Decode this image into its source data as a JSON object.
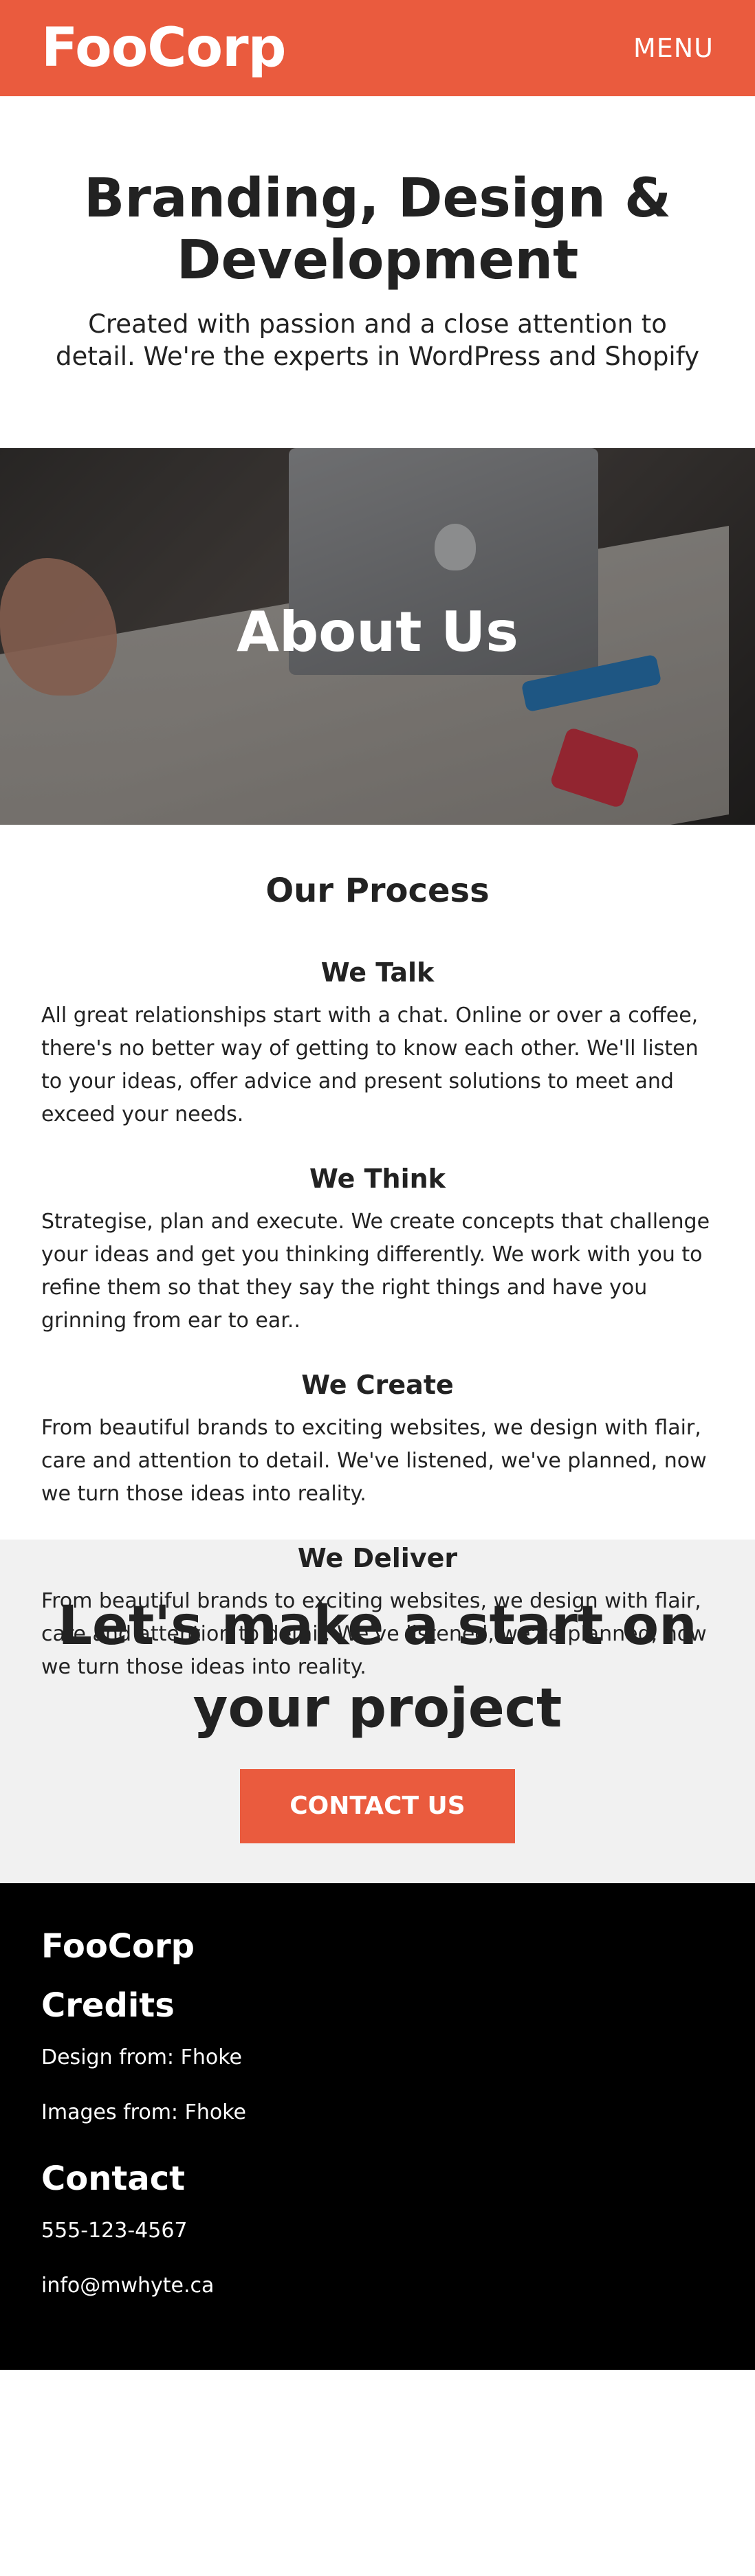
{
  "header": {
    "logo": "FooCorp",
    "menu_label": "MENU"
  },
  "hero": {
    "title": "Branding, Design & Development",
    "subtitle": "Created with passion and a close attention to detail. We're the experts in WordPress and Shopify"
  },
  "about": {
    "title": "About Us"
  },
  "process": {
    "title": "Our Process",
    "steps": [
      {
        "title": "We Talk",
        "text": "All great relationships start with a chat. Online or over a coffee, there's no better way of getting to know each other. We'll listen to your ideas, offer advice and present solutions to meet and exceed your needs."
      },
      {
        "title": "We Think",
        "text": "Strategise, plan and execute. We create concepts that challenge your ideas and get you thinking differently. We work with you to refine them so that they say the right things and have you grinning from ear to ear.."
      },
      {
        "title": "We Create",
        "text": "From beautiful brands to exciting websites, we design with flair, care and attention to detail. We've listened, we've planned, now we turn those ideas into reality."
      },
      {
        "title": "We Deliver",
        "text": "From beautiful brands to exciting websites, we design with flair, care and attention to detail. We've listened, we've planned, now we turn those ideas into reality."
      }
    ]
  },
  "cta": {
    "title": "Let's make a start on your project",
    "button_label": "CONTACT US"
  },
  "footer": {
    "brand": "FooCorp",
    "credits_title": "Credits",
    "design_credit": "Design from: Fhoke",
    "images_credit": "Images from: Fhoke",
    "contact_title": "Contact",
    "phone": "555-123-4567",
    "email": "info@mwhyte.ca"
  },
  "colors": {
    "accent": "#ea5b3e",
    "cta_background": "#f1f1f1",
    "footer_background": "#000000"
  }
}
